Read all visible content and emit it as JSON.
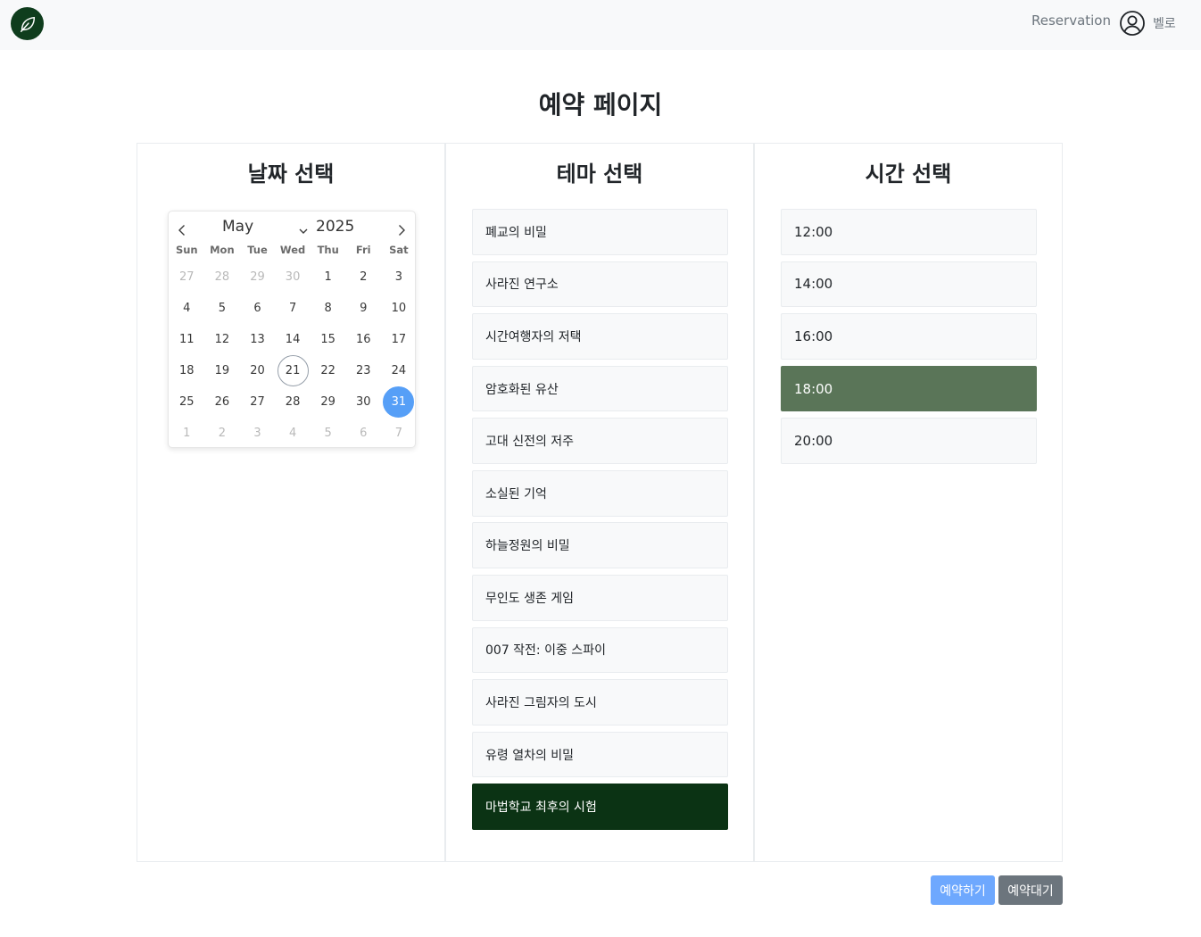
{
  "nav": {
    "reservation_label": "Reservation",
    "user_name": "벨로"
  },
  "page_title": "예약 페이지",
  "date_panel": {
    "title": "날짜 선택",
    "calendar": {
      "month": "May",
      "year": "2025",
      "weekdays": [
        "Sun",
        "Mon",
        "Tue",
        "Wed",
        "Thu",
        "Fri",
        "Sat"
      ],
      "days": [
        {
          "label": "27",
          "muted": true
        },
        {
          "label": "28",
          "muted": true
        },
        {
          "label": "29",
          "muted": true
        },
        {
          "label": "30",
          "muted": true
        },
        {
          "label": "1"
        },
        {
          "label": "2"
        },
        {
          "label": "3"
        },
        {
          "label": "4"
        },
        {
          "label": "5"
        },
        {
          "label": "6"
        },
        {
          "label": "7"
        },
        {
          "label": "8"
        },
        {
          "label": "9"
        },
        {
          "label": "10"
        },
        {
          "label": "11"
        },
        {
          "label": "12"
        },
        {
          "label": "13"
        },
        {
          "label": "14"
        },
        {
          "label": "15"
        },
        {
          "label": "16"
        },
        {
          "label": "17"
        },
        {
          "label": "18"
        },
        {
          "label": "19"
        },
        {
          "label": "20"
        },
        {
          "label": "21",
          "today": true
        },
        {
          "label": "22"
        },
        {
          "label": "23"
        },
        {
          "label": "24"
        },
        {
          "label": "25"
        },
        {
          "label": "26"
        },
        {
          "label": "27"
        },
        {
          "label": "28"
        },
        {
          "label": "29"
        },
        {
          "label": "30"
        },
        {
          "label": "31",
          "selected": true
        },
        {
          "label": "1",
          "muted": true
        },
        {
          "label": "2",
          "muted": true
        },
        {
          "label": "3",
          "muted": true
        },
        {
          "label": "4",
          "muted": true
        },
        {
          "label": "5",
          "muted": true
        },
        {
          "label": "6",
          "muted": true
        },
        {
          "label": "7",
          "muted": true
        }
      ]
    }
  },
  "theme_panel": {
    "title": "테마 선택",
    "items": [
      {
        "label": "폐교의 비밀"
      },
      {
        "label": "사라진 연구소"
      },
      {
        "label": "시간여행자의 저택"
      },
      {
        "label": "암호화된 유산"
      },
      {
        "label": "고대 신전의 저주"
      },
      {
        "label": "소실된 기억"
      },
      {
        "label": "하늘정원의 비밀"
      },
      {
        "label": "무인도 생존 게임"
      },
      {
        "label": "007 작전: 이중 스파이"
      },
      {
        "label": "사라진 그림자의 도시"
      },
      {
        "label": "유령 열차의 비밀"
      },
      {
        "label": "마법학교 최후의 시험",
        "active": true
      }
    ]
  },
  "time_panel": {
    "title": "시간 선택",
    "items": [
      {
        "label": "12:00"
      },
      {
        "label": "14:00"
      },
      {
        "label": "16:00"
      },
      {
        "label": "18:00",
        "active": true
      },
      {
        "label": "20:00"
      }
    ]
  },
  "buttons": {
    "reserve_label": "예약하기",
    "wait_label": "예약대기"
  },
  "colors": {
    "selected_date": "#569ff7",
    "selected_theme": "#0b3314",
    "selected_time": "#5a7558",
    "reserve_button": "#6ea8fe",
    "wait_button": "#6c757d",
    "logo_bg": "#0f3d1d"
  },
  "icons": {
    "logo": "leaf-icon",
    "profile": "user-circle-icon",
    "prev_month": "chevron-left-icon",
    "next_month": "chevron-right-icon",
    "month_dropdown": "chevron-down-icon"
  }
}
